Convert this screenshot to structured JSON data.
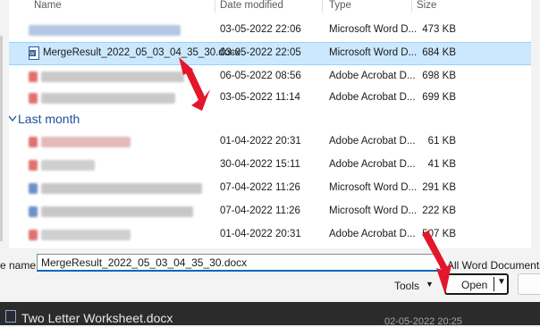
{
  "columns": {
    "name": "Name",
    "date": "Date modified",
    "type": "Type",
    "size": "Size"
  },
  "group_last_month": "Last month",
  "rows": [
    {
      "name": "",
      "date": "03-05-2022 22:06",
      "type": "Microsoft Word D...",
      "size": "473 KB",
      "blur_color": "#9ab6d8"
    },
    {
      "name": "MergeResult_2022_05_03_04_35_30.docx",
      "date": "03-05-2022 22:05",
      "type": "Microsoft Word D...",
      "size": "684 KB",
      "selected": true
    },
    {
      "name": "",
      "date": "06-05-2022 08:56",
      "type": "Adobe Acrobat D...",
      "size": "698 KB",
      "blur_color": "#e8a4a4"
    },
    {
      "name": "",
      "date": "03-05-2022 11:14",
      "type": "Adobe Acrobat D...",
      "size": "699 KB",
      "blur_color": "#e8a4a4"
    },
    {
      "name": "",
      "date": "01-04-2022 20:31",
      "type": "Adobe Acrobat D...",
      "size": "61 KB",
      "blur_color": "#e8a4a4"
    },
    {
      "name": "",
      "date": "30-04-2022 15:11",
      "type": "Adobe Acrobat D...",
      "size": "41 KB",
      "blur_color": "#e8a4a4"
    },
    {
      "name": "",
      "date": "07-04-2022 11:26",
      "type": "Microsoft Word D...",
      "size": "291 KB",
      "blur_color": "#9ab6d8"
    },
    {
      "name": "",
      "date": "07-04-2022 11:26",
      "type": "Microsoft Word D...",
      "size": "222 KB",
      "blur_color": "#9ab6d8"
    },
    {
      "name": "",
      "date": "01-04-2022 20:31",
      "type": "Adobe Acrobat D...",
      "size": "507 KB",
      "blur_color": "#e8a4a4"
    }
  ],
  "file_name_label": "e name:",
  "file_name_value": "MergeResult_2022_05_03_04_35_30.docx",
  "file_type_filter": "All Word Documents (*.",
  "tools_label": "Tools",
  "open_label": "Open",
  "taskbar_title": "Two Letter Worksheet.docx",
  "taskbar_date": "02-05-2022 20:25",
  "colors": {
    "accent": "#0067c0",
    "selection": "#cce8ff",
    "arrow": "#e3162b"
  }
}
